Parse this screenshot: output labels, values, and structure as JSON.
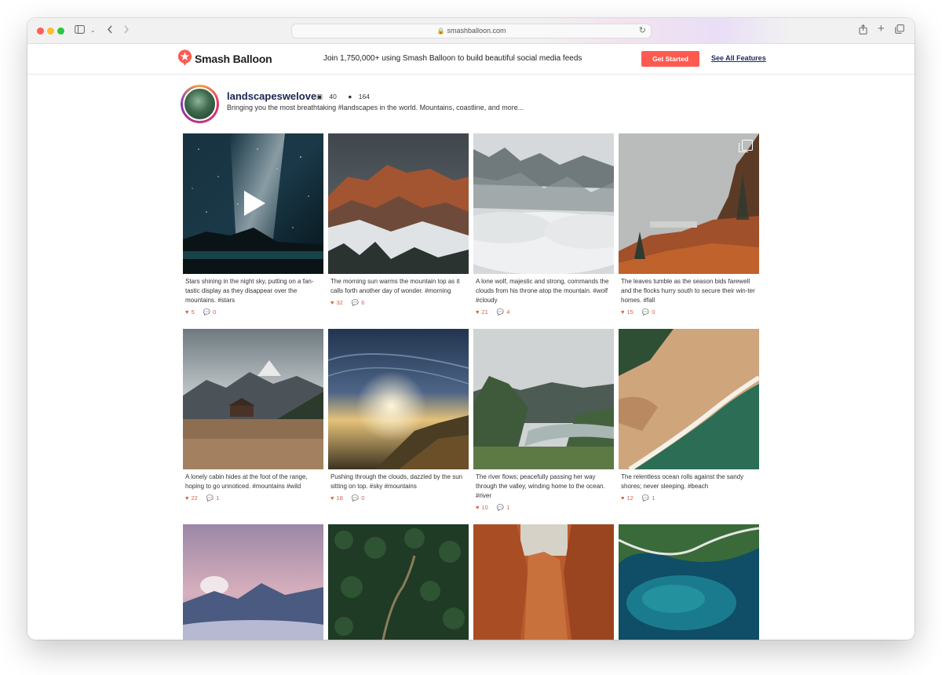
{
  "browser": {
    "url": "smashballoon.com"
  },
  "site": {
    "logo_text": "Smash Balloon",
    "promo": "Join 1,750,000+ using Smash Balloon to build beautiful social media feeds",
    "cta_label": "Get Started",
    "features_link": "See All Features",
    "accent_color": "#ff5a4f"
  },
  "profile": {
    "handle": "landscapeswelove",
    "posts_count": "40",
    "followers_count": "164",
    "bio": "Bringing you the most breathtaking #landscapes in the world. Mountains, coastline, and more..."
  },
  "posts": [
    {
      "caption": "Stars shining in the night sky, putting on a fan-tastic display as they disappear over the mountains. #stars",
      "likes": "5",
      "comments": "0",
      "media": "video"
    },
    {
      "caption": "The morning sun warms the mountain top as it calls forth another day of wonder. #morning",
      "likes": "32",
      "comments": "6",
      "media": "image"
    },
    {
      "caption": "A lone wolf, majestic and strong, commands the clouds from his throne atop the mountain. #wolf #cloudy",
      "likes": "21",
      "comments": "4",
      "media": "image"
    },
    {
      "caption": "The leaves tumble as the season bids farewell and the flocks hurry south to secure their win-ter homes. #fall",
      "likes": "15",
      "comments": "0",
      "media": "carousel"
    },
    {
      "caption": "A lonely cabin hides at the foot of the range, hoping to go unnoticed. #mountains #wild",
      "likes": "22",
      "comments": "1",
      "media": "image"
    },
    {
      "caption": "Pushing through the clouds, dazzled by the sun sitting on top. #sky #mountains",
      "likes": "18",
      "comments": "0",
      "media": "image"
    },
    {
      "caption": "The river flows; peacefully passing her way through the valley, winding home to the ocean. #river",
      "likes": "10",
      "comments": "1",
      "media": "image"
    },
    {
      "caption": "The relentless ocean rolls against the sandy shores; never sleeping. #beach",
      "likes": "12",
      "comments": "1",
      "media": "image"
    },
    {
      "caption": "",
      "likes": "",
      "comments": "",
      "media": "image"
    },
    {
      "caption": "",
      "likes": "",
      "comments": "",
      "media": "image"
    },
    {
      "caption": "",
      "likes": "",
      "comments": "",
      "media": "image"
    },
    {
      "caption": "",
      "likes": "",
      "comments": "",
      "media": "image"
    }
  ]
}
